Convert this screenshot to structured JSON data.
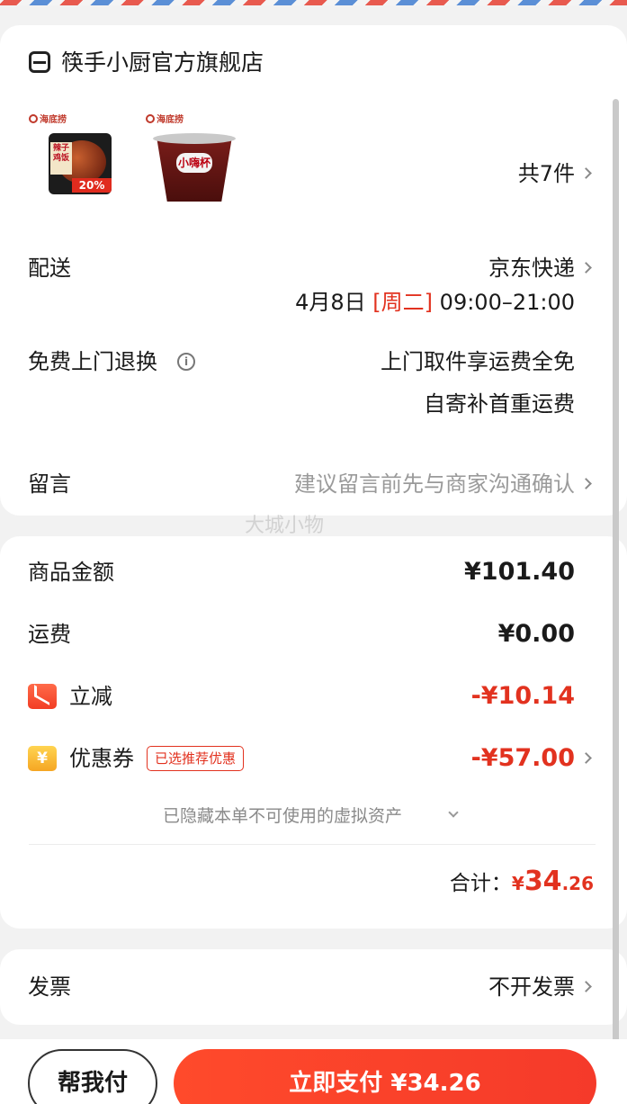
{
  "store": {
    "name": "筷手小厨官方旗舰店",
    "icon": "store-icon"
  },
  "products": {
    "thumb1": {
      "brand": "海底捞",
      "tag": "辣子鸡饭",
      "badge": "20%"
    },
    "thumb2": {
      "brand": "海底捞",
      "logo": "小嗨杯"
    },
    "count_label": "共7件"
  },
  "delivery": {
    "label": "配送",
    "carrier": "京东快递",
    "date": "4月8日",
    "weekday": "[周二]",
    "time": "09:00–21:00"
  },
  "returns": {
    "label": "免费上门退换",
    "line1": "上门取件享运费全免",
    "line2": "自寄补首重运费"
  },
  "message": {
    "label": "留言",
    "placeholder": "建议留言前先与商家沟通确认"
  },
  "watermark": "大城小物",
  "summary": {
    "goods_label": "商品金额",
    "goods_value": "¥101.40",
    "shipping_label": "运费",
    "shipping_value": "¥0.00",
    "discount_label": "立减",
    "discount_value": "-¥10.14",
    "coupon_label": "优惠券",
    "coupon_tag": "已选推荐优惠",
    "coupon_icon_text": "¥",
    "coupon_value": "-¥57.00",
    "hidden_assets": "已隐藏本单不可使用的虚拟资产",
    "total_label": "合计：",
    "total_currency": "¥",
    "total_int": "34",
    "total_dec": ".26"
  },
  "invoice": {
    "label": "发票",
    "value": "不开发票"
  },
  "actions": {
    "help_pay": "帮我付",
    "pay_now": "立即支付 ¥34.26"
  },
  "colors": {
    "accent": "#e2321f",
    "pay_button": "#f53a2a"
  }
}
